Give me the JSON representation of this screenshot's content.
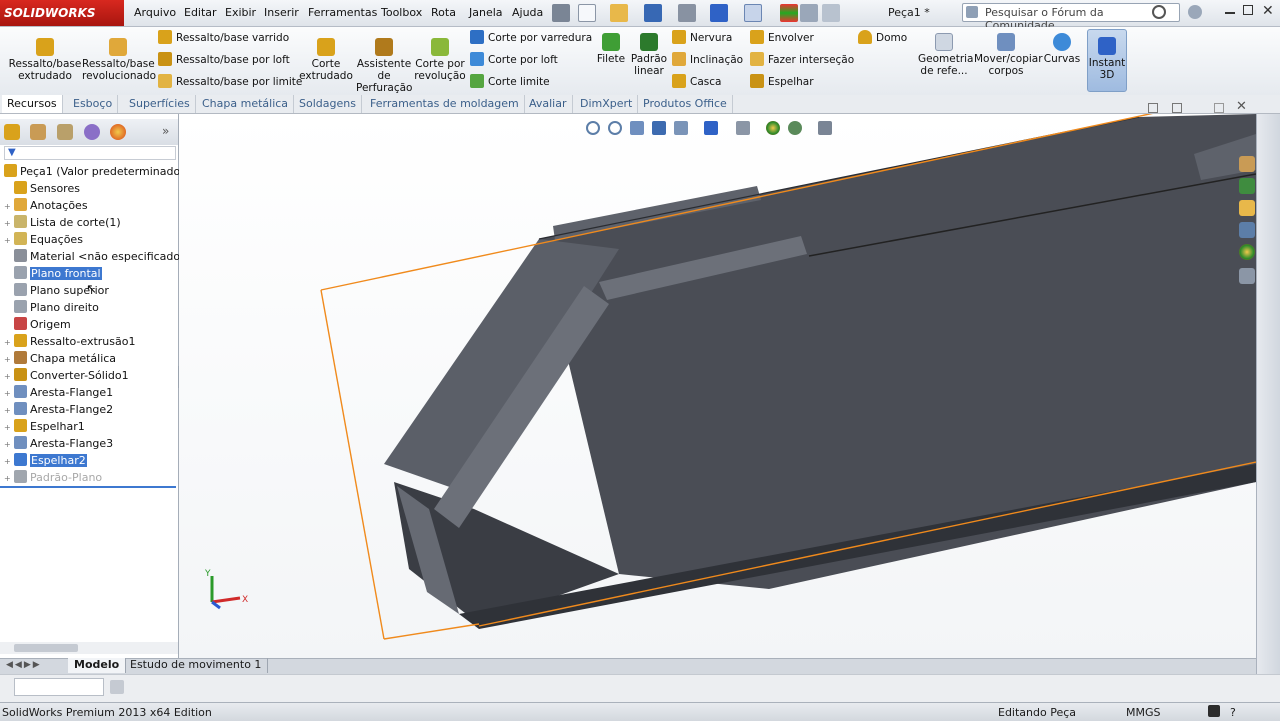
{
  "app": {
    "logo": "SOLIDWORKS",
    "document_title": "Peça1 *",
    "search_placeholder": "Pesquisar o Fórum da Comunidade",
    "help": "?"
  },
  "menu": [
    "Arquivo",
    "Editar",
    "Exibir",
    "Inserir",
    "Ferramentas",
    "Toolbox",
    "Rota",
    "Janela",
    "Ajuda"
  ],
  "ribbon": {
    "extrude_boss": "Ressalto/base extrudado",
    "revolve_boss": "Ressalto/base revolucionado",
    "swept_boss": "Ressalto/base varrido",
    "loft_boss": "Ressalto/base por loft",
    "boundary_boss": "Ressalto/base por limite",
    "extrude_cut": "Corte extrudado",
    "hole_wizard": "Assistente de Perfuração",
    "revolve_cut": "Corte por revolução",
    "swept_cut": "Corte por varredura",
    "loft_cut": "Corte por loft",
    "boundary_cut": "Corte limite",
    "fillet": "Filete",
    "linear_pattern": "Padrão linear",
    "rib": "Nervura",
    "draft": "Inclinação",
    "shell": "Casca",
    "wrap": "Envolver",
    "intersect": "Fazer interseção",
    "mirror": "Espelhar",
    "dome": "Domo",
    "ref_geometry": "Geometria de refe...",
    "move_copy": "Mover/copiar corpos",
    "curves": "Curvas",
    "instant3d": "Instant 3D"
  },
  "command_tabs": [
    "Recursos",
    "Esboço",
    "Superfícies",
    "Chapa metálica",
    "Soldagens",
    "Ferramentas de moldagem",
    "Avaliar",
    "DimXpert",
    "Produtos Office"
  ],
  "tree": {
    "root": "Peça1  (Valor predeterminado<",
    "items": [
      {
        "label": "Sensores",
        "exp": ""
      },
      {
        "label": "Anotações",
        "exp": "+"
      },
      {
        "label": "Lista de corte(1)",
        "exp": "+"
      },
      {
        "label": "Equações",
        "exp": "+"
      },
      {
        "label": "Material <não especificado",
        "exp": ""
      },
      {
        "label": "Plano frontal",
        "exp": ""
      },
      {
        "label": "Plano superior",
        "exp": ""
      },
      {
        "label": "Plano direito",
        "exp": ""
      },
      {
        "label": "Origem",
        "exp": ""
      },
      {
        "label": "Ressalto-extrusão1",
        "exp": "+"
      },
      {
        "label": "Chapa metálica",
        "exp": "+"
      },
      {
        "label": "Converter-Sólido1",
        "exp": "+"
      },
      {
        "label": "Aresta-Flange1",
        "exp": "+"
      },
      {
        "label": "Aresta-Flange2",
        "exp": "+"
      },
      {
        "label": "Espelhar1",
        "exp": "+"
      },
      {
        "label": "Aresta-Flange3",
        "exp": "+"
      },
      {
        "label": "Espelhar2",
        "exp": "+"
      },
      {
        "label": "Padrão-Plano",
        "exp": "+"
      }
    ]
  },
  "triad": {
    "x": "X",
    "y": "Y"
  },
  "bottom_tabs": [
    "Modelo",
    "Estudo de movimento 1"
  ],
  "status": {
    "edition": "SolidWorks Premium 2013 x64 Edition",
    "mode": "Editando Peça",
    "units": "MMGS",
    "help": "?"
  },
  "colors": {
    "accent": "#3d78d0",
    "logo_red": "#c8201a",
    "plane": "#f08a1c",
    "body": "#4a4d55"
  }
}
